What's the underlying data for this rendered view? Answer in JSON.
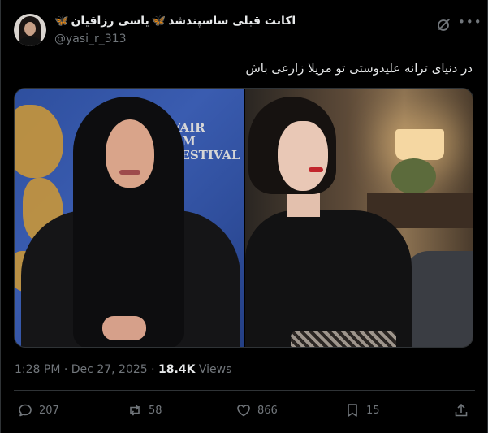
{
  "author": {
    "display_name": "یاسی رزاقیان",
    "display_suffix": "اکانت قبلی ساسپندشد",
    "emoji": "🦋",
    "handle": "@yasi_r_313"
  },
  "tweet": {
    "text": "در دنیای ترانه علیدوستی تو مریلا زارعی باش"
  },
  "media": {
    "left_image_text": "7 FAIR FILM\nL FESTIVAL",
    "left_fest_line1": "7 FAIR FILM",
    "left_fest_line2": "L FESTIVAL"
  },
  "meta": {
    "time": "1:28 PM",
    "separator": "·",
    "date": "Dec 27, 2025",
    "views_count": "18.4K",
    "views_label": "Views"
  },
  "actions": {
    "replies": "207",
    "reposts": "58",
    "likes": "866",
    "bookmarks": "15"
  },
  "icons": {
    "more": "more-icon",
    "grok": "grok-icon",
    "reply": "reply-icon",
    "repost": "repost-icon",
    "like": "heart-icon",
    "bookmark": "bookmark-icon",
    "share": "share-icon"
  },
  "colors": {
    "background": "#000000",
    "text": "#e7e9ea",
    "muted": "#71767b",
    "border": "#2f3336",
    "butterfly": "#3f8fe8"
  }
}
